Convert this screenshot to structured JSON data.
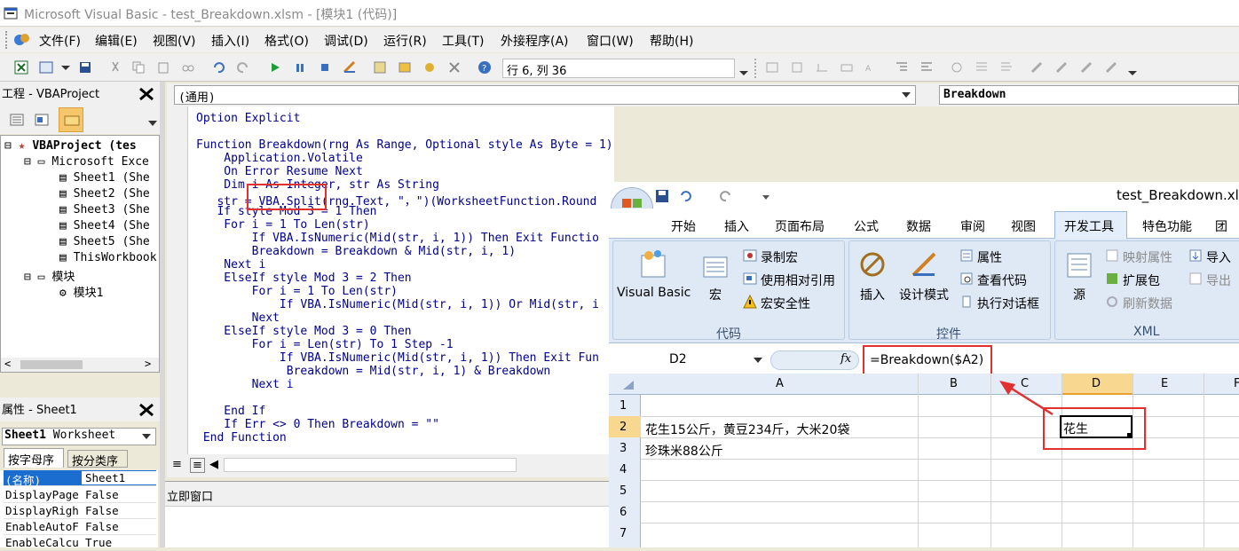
{
  "window": {
    "title": "Microsoft Visual Basic - test_Breakdown.xlsm - [模块1 (代码)]"
  },
  "menu": [
    "文件(F)",
    "编辑(E)",
    "视图(V)",
    "插入(I)",
    "格式(O)",
    "调试(D)",
    "运行(R)",
    "工具(T)",
    "外接程序(A)",
    "窗口(W)",
    "帮助(H)"
  ],
  "toolbar": {
    "position_label": "行 6, 列 36"
  },
  "project": {
    "title": "工程 - VBAProject",
    "root": "VBAProject (tes",
    "folder_objects": "Microsoft Exce",
    "sheets": [
      "Sheet1 (She",
      "Sheet2 (She",
      "Sheet3 (She",
      "Sheet4 (She",
      "Sheet5 (She",
      "ThisWorkbook"
    ],
    "folder_modules": "模块",
    "module": "模块1"
  },
  "properties": {
    "title": "属性 - Sheet1",
    "object_name": "Sheet1",
    "object_type": "Worksheet",
    "tab_alpha": "按字母序",
    "tab_cat": "按分类序",
    "rows": [
      {
        "name": "(名称)",
        "value": "Sheet1"
      },
      {
        "name": "DisplayPage",
        "value": "False"
      },
      {
        "name": "DisplayRigh",
        "value": "False"
      },
      {
        "name": "EnableAutoF",
        "value": "False"
      },
      {
        "name": "EnableCalcu",
        "value": "True"
      }
    ]
  },
  "code": {
    "object_combo": "(通用)",
    "proc_combo": "Breakdown",
    "lines": [
      "Option Explicit",
      "",
      "Function Breakdown(rng As Range, Optional style As Byte = 1) As String",
      "    Application.Volatile",
      "    On Error Resume Next",
      "    Dim i As Integer, str As String",
      "   str = VBA.Split(rng.Text, \"，\")(WorksheetFunction.Round",
      "   If style Mod 3 = 1 Then",
      "    For i = 1 To Len(str)",
      "        If VBA.IsNumeric(Mid(str, i, 1)) Then Exit Functio",
      "        Breakdown = Breakdown & Mid(str, i, 1)",
      "    Next i",
      "    ElseIf style Mod 3 = 2 Then",
      "        For i = 1 To Len(str)",
      "            If VBA.IsNumeric(Mid(str, i, 1)) Or Mid(str, i",
      "        Next",
      "    ElseIf style Mod 3 = 0 Then",
      "        For i = Len(str) To 1 Step -1",
      "            If VBA.IsNumeric(Mid(str, i, 1)) Then Exit Fun",
      "             Breakdown = Mid(str, i, 1) & Breakdown",
      "        Next i",
      "",
      "    End If",
      "    If Err <> 0 Then Breakdown = \"\"",
      " End Function"
    ]
  },
  "immediate": {
    "title": "立即窗口"
  },
  "excel": {
    "filename": "test_Breakdown.xls",
    "tabs": [
      "开始",
      "插入",
      "页面布局",
      "公式",
      "数据",
      "审阅",
      "视图",
      "开发工具",
      "特色功能",
      "团"
    ],
    "active_tab": "开发工具",
    "ribbon": {
      "code_group": "代码",
      "visual_basic": "Visual Basic",
      "macro": "宏",
      "record_macro": "录制宏",
      "relative_ref": "使用相对引用",
      "macro_security": "宏安全性",
      "controls_group": "控件",
      "insert": "插入",
      "design_mode": "设计模式",
      "properties": "属性",
      "view_code": "查看代码",
      "run_dialog": "执行对话框",
      "xml_group": "XML",
      "source": "源",
      "map_props": "映射属性",
      "expansion": "扩展包",
      "refresh": "刷新数据",
      "import": "导入",
      "export": "导出"
    },
    "name_box": "D2",
    "fx": "fx",
    "formula": "=Breakdown($A2)",
    "columns": [
      "A",
      "B",
      "C",
      "D",
      "E",
      "F"
    ],
    "rows": [
      "1",
      "2",
      "3",
      "4",
      "5",
      "6",
      "7"
    ],
    "a2": "花生15公斤，黄豆234斤，大米20袋",
    "a3": "珍珠米88公斤",
    "d2": "花生"
  }
}
